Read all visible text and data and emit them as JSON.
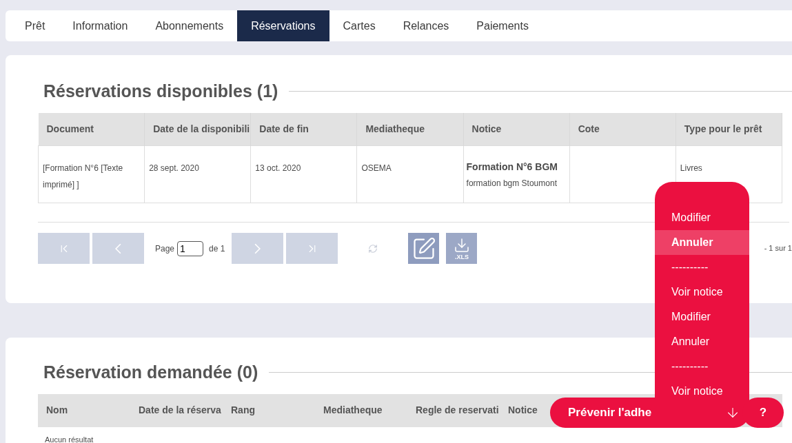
{
  "tabs": [
    {
      "label": "Prêt",
      "selected": false
    },
    {
      "label": "Information",
      "selected": false
    },
    {
      "label": "Abonnements",
      "selected": false
    },
    {
      "label": "Réservations",
      "selected": true
    },
    {
      "label": "Cartes",
      "selected": false
    },
    {
      "label": "Relances",
      "selected": false
    },
    {
      "label": "Paiements",
      "selected": false
    }
  ],
  "available": {
    "title": "Réservations disponibles (1)",
    "columns": [
      "Document",
      "Date de la disponibili",
      "Date de fin",
      "Mediatheque",
      "Notice",
      "Cote",
      "Type pour le prêt"
    ],
    "rows": [
      {
        "document": "[Formation N°6 [Texte imprimé] ]",
        "available_date": "28 sept. 2020",
        "end_date": "13 oct. 2020",
        "library": "OSEMA",
        "notice_title": "Formation N°6 BGM",
        "notice_subtitle": "formation bgm Stoumont",
        "cote": "",
        "loan_type": "Livres"
      }
    ],
    "pager": {
      "page_label": "Page",
      "page": "1",
      "of_label": "de 1",
      "summary": "- 1 sur 1"
    }
  },
  "menu": {
    "items": [
      {
        "label": "Modifier",
        "kind": "item",
        "selected": false
      },
      {
        "label": "Annuler",
        "kind": "item",
        "selected": true
      },
      {
        "label": "----------",
        "kind": "separator",
        "selected": false
      },
      {
        "label": "Voir notice",
        "kind": "item",
        "selected": false
      },
      {
        "label": "Modifier",
        "kind": "item",
        "selected": false
      },
      {
        "label": "Annuler",
        "kind": "item",
        "selected": false
      },
      {
        "label": "----------",
        "kind": "separator",
        "selected": false
      },
      {
        "label": "Voir notice",
        "kind": "item",
        "selected": false
      }
    ]
  },
  "requested": {
    "title": "Réservation demandée (0)",
    "columns": [
      "Nom",
      "Date de la réserva",
      "Rang",
      "Mediatheque",
      "Regle de reservati",
      "Notice"
    ],
    "empty": "Aucun résultat"
  },
  "notify_button": "Prévenir l'adhe",
  "help_button": "?",
  "export_label": ".XLS"
}
